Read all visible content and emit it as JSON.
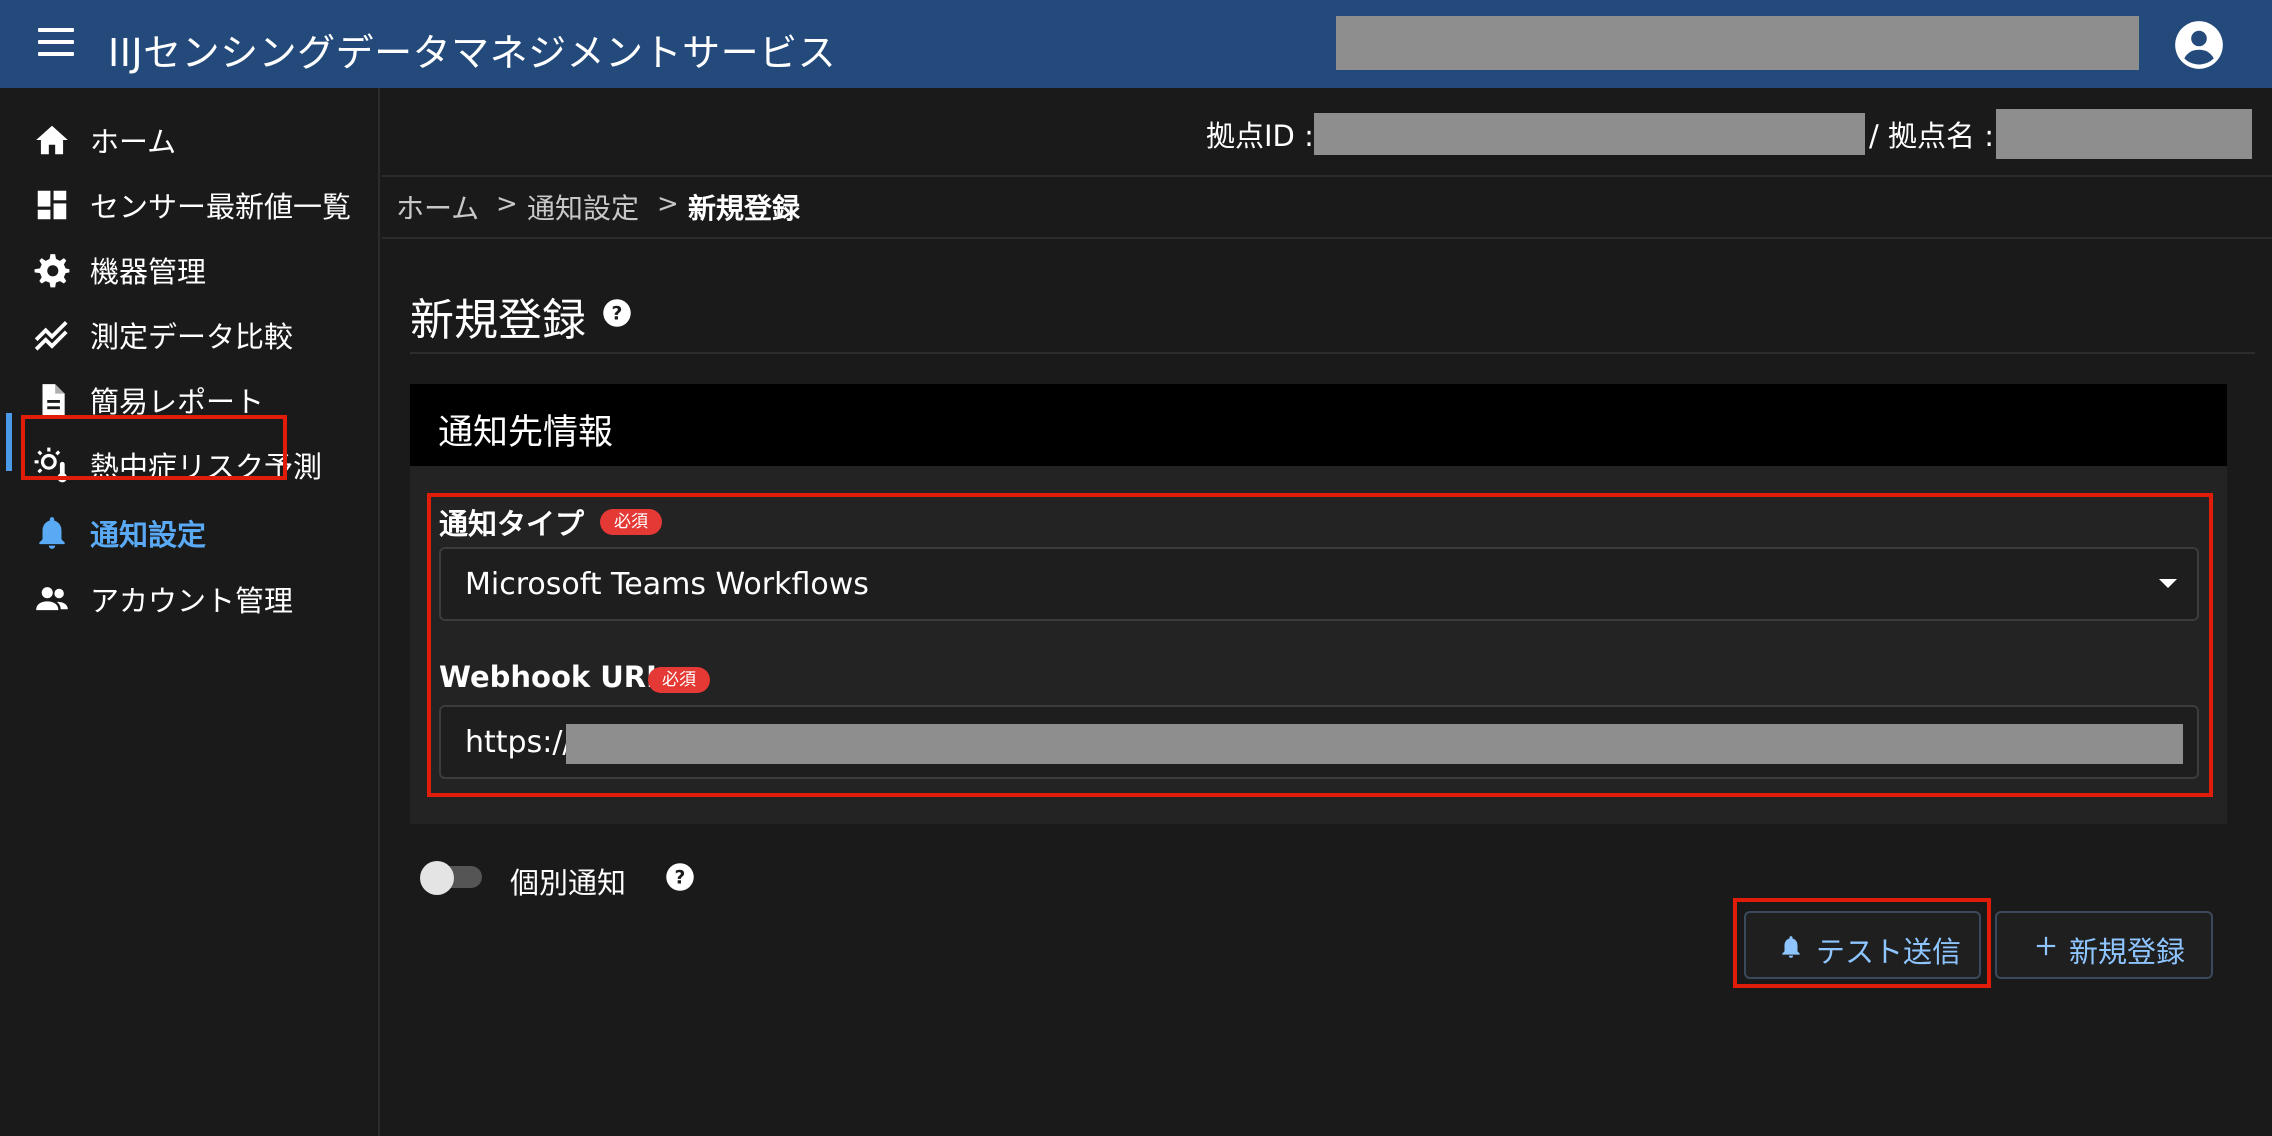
{
  "header": {
    "title": "IIJセンシングデータマネジメントサービス"
  },
  "sidebar": {
    "items": [
      {
        "label": "ホーム",
        "icon": "home-icon"
      },
      {
        "label": "センサー最新値一覧",
        "icon": "dashboard-icon"
      },
      {
        "label": "機器管理",
        "icon": "gear-icon"
      },
      {
        "label": "測定データ比較",
        "icon": "trend-icon"
      },
      {
        "label": "簡易レポート",
        "icon": "document-icon"
      },
      {
        "label": "熱中症リスク予測",
        "icon": "sun-thermometer-icon"
      },
      {
        "label": "通知設定",
        "icon": "bell-icon",
        "active": true
      },
      {
        "label": "アカウント管理",
        "icon": "people-icon"
      }
    ]
  },
  "site": {
    "id_label": "拠点ID :",
    "name_label": "/ 拠点名 :"
  },
  "breadcrumb": {
    "items": [
      "ホーム",
      "通知設定",
      "新規登録"
    ],
    "separator": ">"
  },
  "page": {
    "title": "新規登録"
  },
  "card": {
    "title": "通知先情報",
    "notify_type": {
      "label": "通知タイプ",
      "required": "必須",
      "value": "Microsoft Teams Workflows"
    },
    "webhook": {
      "label": "Webhook URL",
      "required": "必須",
      "value_prefix": "https://"
    }
  },
  "individual": {
    "label": "個別通知",
    "checked": false
  },
  "buttons": {
    "test_send": "テスト送信",
    "new_register": "新規登録"
  },
  "colors": {
    "appbar": "#234a7a",
    "accent": "#5aa9f5",
    "highlight": "#e11d0a",
    "badge": "#e53935"
  }
}
